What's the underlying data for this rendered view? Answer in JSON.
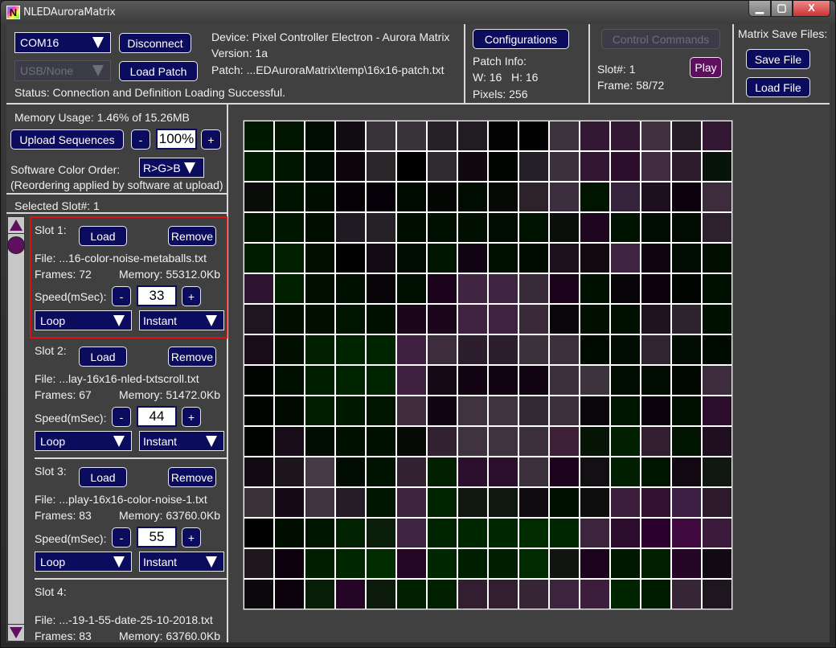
{
  "window": {
    "title": "NLEDAuroraMatrix",
    "icon_letter": "N",
    "controls": {
      "minimize": "▁",
      "maximize": "▢",
      "close": "X"
    }
  },
  "connection": {
    "port_select": "COM16",
    "interface_select": "USB/None",
    "disconnect_label": "Disconnect",
    "load_patch_label": "Load Patch",
    "device": "Device: Pixel Controller Electron - Aurora Matrix",
    "version": "Version: 1a",
    "patch": "Patch: ...EDAuroraMatrix\\temp\\16x16-patch.txt",
    "status": "Status: Connection and Definition Loading Successful."
  },
  "patch_info": {
    "configurations_label": "Configurations",
    "heading": "Patch Info:",
    "wh": "W: 16   H: 16",
    "pixels": "Pixels: 256"
  },
  "playback": {
    "control_commands_label": "Control Commands",
    "slot": "Slot#: 1",
    "frame": "Frame: 58/72",
    "play_label": "Play"
  },
  "save_files": {
    "heading": "Matrix Save Files:",
    "save_label": "Save File",
    "load_label": "Load File"
  },
  "memory": {
    "usage": "Memory Usage: 1.46% of 15.26MB",
    "upload_label": "Upload Sequences",
    "minus": "-",
    "plus": "+",
    "brightness": "100%",
    "color_order_label": "Software Color Order:",
    "color_order_value": "R>G>B",
    "reorder_note": "(Reordering applied by software at upload)",
    "selected_slot": "Selected Slot#: 1"
  },
  "slots": [
    {
      "title": "Slot 1:",
      "load": "Load",
      "remove": "Remove",
      "file": "File: ...16-color-noise-metaballs.txt",
      "frames": "Frames: 72",
      "memory": "Memory: 55312.0Kb",
      "speed_label": "Speed(mSec):",
      "speed": "33",
      "minus": "-",
      "plus": "+",
      "mode": "Loop",
      "transition": "Instant"
    },
    {
      "title": "Slot 2:",
      "load": "Load",
      "remove": "Remove",
      "file": "File: ...lay-16x16-nled-txtscroll.txt",
      "frames": "Frames: 67",
      "memory": "Memory: 51472.0Kb",
      "speed_label": "Speed(mSec):",
      "speed": "44",
      "minus": "-",
      "plus": "+",
      "mode": "Loop",
      "transition": "Instant"
    },
    {
      "title": "Slot 3:",
      "load": "Load",
      "remove": "Remove",
      "file": "File: ...play-16x16-color-noise-1.txt",
      "frames": "Frames: 83",
      "memory": "Memory: 63760.0Kb",
      "speed_label": "Speed(mSec):",
      "speed": "55",
      "minus": "-",
      "plus": "+",
      "mode": "Loop",
      "transition": "Instant"
    },
    {
      "title": "Slot 4:",
      "file": "File: ...-19-1-55-date-25-10-2018.txt",
      "frames": "Frames: 83",
      "memory": "Memory: 63760.0Kb"
    }
  ],
  "matrix": {
    "width": 16,
    "height": 16,
    "pixels": [
      [
        "#001a00",
        "#001400",
        "#000c00",
        "#120d12",
        "#39333a",
        "#39333a",
        "#272228",
        "#211c22",
        "#030303",
        "#020202",
        "#3c333c",
        "#331834",
        "#331834",
        "#41303f",
        "#251c28",
        "#331834"
      ],
      [
        "#001c00",
        "#001400",
        "#000c00",
        "#0c060c",
        "#2a2629",
        "#000000",
        "#302a31",
        "#0f080f",
        "#010501",
        "#241f26",
        "#3c303c",
        "#311531",
        "#2c0e2c",
        "#412d41",
        "#2c1c2c",
        "#071407"
      ],
      [
        "#0a0c0a",
        "#001200",
        "#000e00",
        "#040204",
        "#060108",
        "#000b00",
        "#030603",
        "#000c00",
        "#060806",
        "#2d2229",
        "#3c2e3e",
        "#001400",
        "#35233c",
        "#1e0f1e",
        "#0c010c",
        "#3c2c3c"
      ],
      [
        "#001400",
        "#001600",
        "#000e00",
        "#201b22",
        "#272228",
        "#000e00",
        "#001000",
        "#000f00",
        "#000c00",
        "#001300",
        "#0b0f0b",
        "#1e061e",
        "#001200",
        "#000d00",
        "#000c00",
        "#2e212e"
      ],
      [
        "#001c00",
        "#002000",
        "#000f00",
        "#010101",
        "#130a13",
        "#000c00",
        "#001500",
        "#120513",
        "#001000",
        "#000b00",
        "#1c111c",
        "#110a11",
        "#3f2542",
        "#120512",
        "#000c00",
        "#000f00"
      ],
      [
        "#2e1430",
        "#002000",
        "#000f00",
        "#001000",
        "#070507",
        "#001000",
        "#1c031c",
        "#402542",
        "#402542",
        "#3a2b3a",
        "#1a031a",
        "#001000",
        "#070507",
        "#0c010c",
        "#010501",
        "#001000"
      ],
      [
        "#1e161e",
        "#000f00",
        "#000f00",
        "#001400",
        "#001100",
        "#1c061c",
        "#1c061c",
        "#402340",
        "#402340",
        "#3a2a3a",
        "#080608",
        "#000f00",
        "#001000",
        "#1e131e",
        "#2d232d",
        "#001100"
      ],
      [
        "#170c17",
        "#000f00",
        "#002000",
        "#002400",
        "#002400",
        "#402040",
        "#3c2c3c",
        "#2d1e2d",
        "#2d1e2d",
        "#3c323c",
        "#3c303c",
        "#000b00",
        "#000c00",
        "#302530",
        "#000c00",
        "#000b00"
      ],
      [
        "#010501",
        "#001000",
        "#001e00",
        "#002400",
        "#002400",
        "#402040",
        "#150915",
        "#120412",
        "#120412",
        "#120412",
        "#3c303c",
        "#3c333c",
        "#000c00",
        "#000c00",
        "#010701",
        "#3c2c3c"
      ],
      [
        "#010501",
        "#010a01",
        "#001e00",
        "#001a00",
        "#001400",
        "#3f2c3f",
        "#120412",
        "#3f333f",
        "#3f333f",
        "#322a32",
        "#3c303c",
        "#080608",
        "#001500",
        "#0c020c",
        "#001000",
        "#2c0e2c"
      ],
      [
        "#000300",
        "#170c17",
        "#000c00",
        "#001100",
        "#001100",
        "#050a05",
        "#322232",
        "#3f333f",
        "#3f333f",
        "#3c303c",
        "#3c2038",
        "#071507",
        "#002000",
        "#311f31",
        "#001400",
        "#200f20"
      ],
      [
        "#120a12",
        "#1c161c",
        "#463a46",
        "#000c00",
        "#001200",
        "#332332",
        "#002000",
        "#2c0f2c",
        "#2c0f2c",
        "#3c303c",
        "#1c051c",
        "#121012",
        "#001e00",
        "#001500",
        "#120812",
        "#111811"
      ],
      [
        "#393339",
        "#160a16",
        "#3f333f",
        "#251c25",
        "#001500",
        "#3c253c",
        "#002400",
        "#0f180f",
        "#0f180f",
        "#100b10",
        "#001000",
        "#0e0e0e",
        "#3c1e3c",
        "#311031",
        "#3c1e44",
        "#2c1a2c"
      ],
      [
        "#010201",
        "#000e00",
        "#001500",
        "#002200",
        "#0a1e0a",
        "#402542",
        "#002400",
        "#002800",
        "#002800",
        "#002c00",
        "#002800",
        "#3c253c",
        "#2c0c2c",
        "#2c002c",
        "#400a40",
        "#3c1a3c"
      ],
      [
        "#1e181e",
        "#0c010c",
        "#001e00",
        "#002600",
        "#002c00",
        "#250625",
        "#002800",
        "#001e00",
        "#001e00",
        "#002a00",
        "#111411",
        "#1c051c",
        "#001800",
        "#002000",
        "#250525",
        "#120a12"
      ],
      [
        "#0c080c",
        "#0c020c",
        "#071d07",
        "#250525",
        "#0c1a0c",
        "#002000",
        "#002000",
        "#311f31",
        "#311f31",
        "#352535",
        "#3c253c",
        "#3c1e3c",
        "#002400",
        "#001c00",
        "#352535",
        "#1e161e"
      ]
    ]
  }
}
